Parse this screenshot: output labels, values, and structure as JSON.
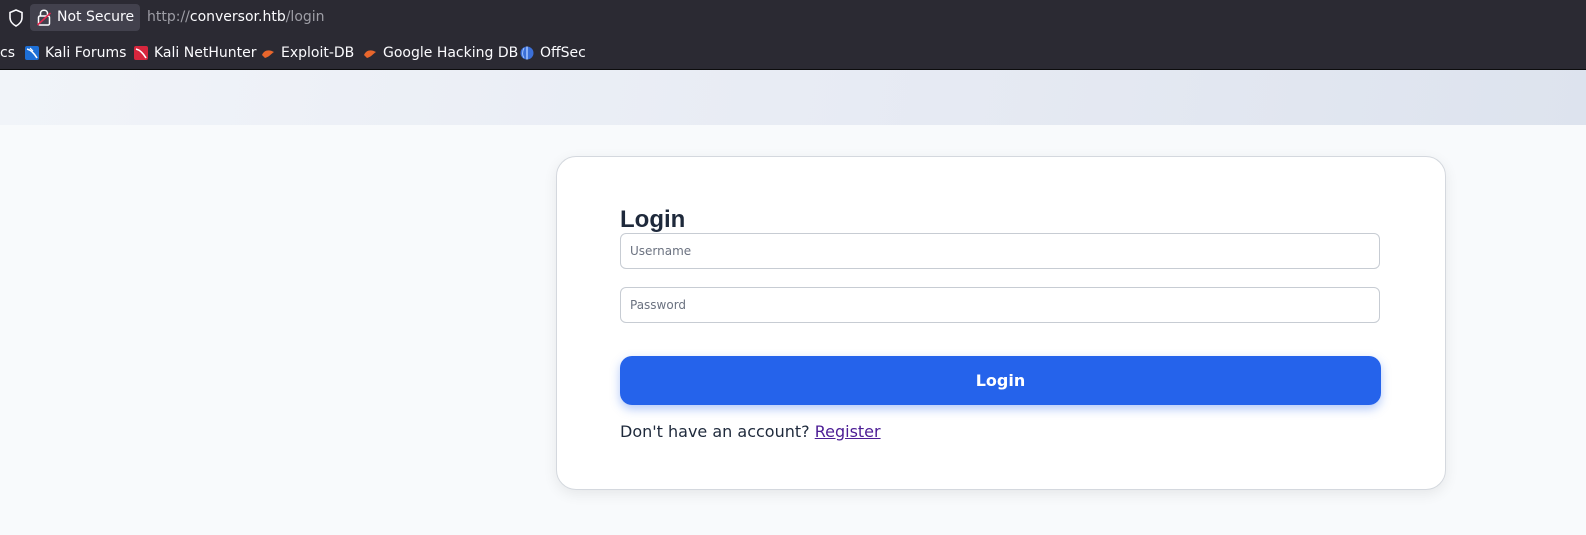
{
  "browser": {
    "security_label": "Not Secure",
    "url_scheme": "http://",
    "url_host": "conversor.htb",
    "url_path": "/login"
  },
  "bookmarks": [
    {
      "label": "cs",
      "icon": "truncated"
    },
    {
      "label": "Kali Forums",
      "icon": "kali-forums-icon"
    },
    {
      "label": "Kali NetHunter",
      "icon": "kali-nethunter-icon"
    },
    {
      "label": "Exploit-DB",
      "icon": "exploit-db-icon"
    },
    {
      "label": "Google Hacking DB",
      "icon": "google-hacking-db-icon"
    },
    {
      "label": "OffSec",
      "icon": "offsec-icon"
    }
  ],
  "login": {
    "title": "Login",
    "username_placeholder": "Username",
    "password_placeholder": "Password",
    "submit_label": "Login",
    "register_prompt": "Don't have an account?",
    "register_link": "Register"
  },
  "colors": {
    "primary": "#2563eb",
    "link": "#4c1d95",
    "chrome": "#2b2a33"
  }
}
